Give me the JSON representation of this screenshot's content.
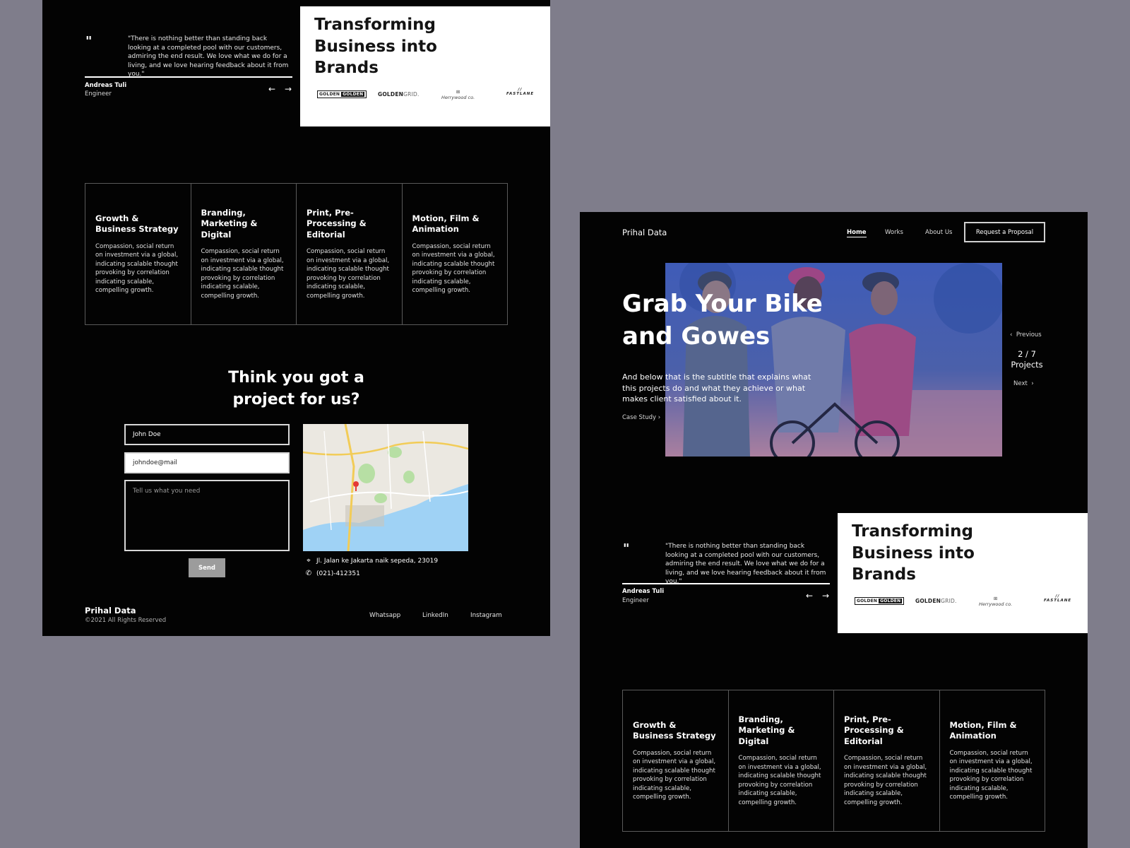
{
  "brand": "Prihal Data",
  "nav": {
    "home": "Home",
    "works": "Works",
    "about": "About Us",
    "cta": "Request a Proposal"
  },
  "hero": {
    "title_line1": "Grab Your Bike",
    "title_line2": "and Gowes",
    "subtitle": "And below that is the subtitle that explains what this projects do and what they achieve or what makes client satisfied about it.",
    "case_study": "Case Study",
    "previous": "Previous",
    "count": "2 / 7",
    "projects": "Projects",
    "next": "Next"
  },
  "testimonial": {
    "mark": "\"",
    "quote": "\"There is nothing better than standing back looking at a completed pool with our customers, admiring the end result. We love what we do for a living, and we love hearing feedback about it from you.\"",
    "author": "Andreas Tuli",
    "role": "Engineer",
    "prev_icon": "arrow-left",
    "next_icon": "arrow-right"
  },
  "brands": {
    "title_line1": "Transforming",
    "title_line2": "Business into",
    "title_line3": "Brands",
    "logos": [
      "GOLDEN",
      "GOLDEN",
      "GOLDEN",
      "GRID.",
      "Herrywood co.",
      "FASTLANE"
    ]
  },
  "services": [
    {
      "title": "Growth & Business Strategy",
      "desc": "Compassion, social return on investment via a global, indicating scalable thought provoking by correlation indicating scalable, compelling growth."
    },
    {
      "title": "Branding, Marketing & Digital",
      "desc": "Compassion, social return on investment via a global, indicating scalable thought provoking by correlation indicating scalable, compelling growth."
    },
    {
      "title": "Print, Pre-Processing & Editorial",
      "desc": "Compassion, social return on investment via a global, indicating scalable thought provoking by correlation indicating scalable, compelling growth."
    },
    {
      "title": "Motion, Film & Animation",
      "desc": "Compassion, social return on investment via a global, indicating scalable thought provoking by correlation indicating scalable, compelling growth."
    }
  ],
  "contact": {
    "title_line1": "Think you got a",
    "title_line2": "project for us?",
    "name_value": "John Doe",
    "email_value": "johndoe@mail",
    "message_placeholder": "Tell us what you need",
    "send": "Send",
    "address": "Jl. Jalan ke Jakarta naik sepeda, 23019",
    "phone": "(021)-412351"
  },
  "footer": {
    "copyright": "©2021 All Rights Reserved",
    "whatsapp": "Whatsapp",
    "linkedin": "LinkedIn",
    "instagram": "Instagram"
  },
  "colors": {
    "page_bg": "#7f7d8b",
    "panel_bg": "#030303",
    "card_bg": "#ffffff",
    "send_btn": "#9c9c9c"
  },
  "icons": {
    "address": "map-pin-icon",
    "phone": "phone-icon",
    "chevron_left": "chevron-left-icon",
    "chevron_right": "chevron-right-icon"
  }
}
